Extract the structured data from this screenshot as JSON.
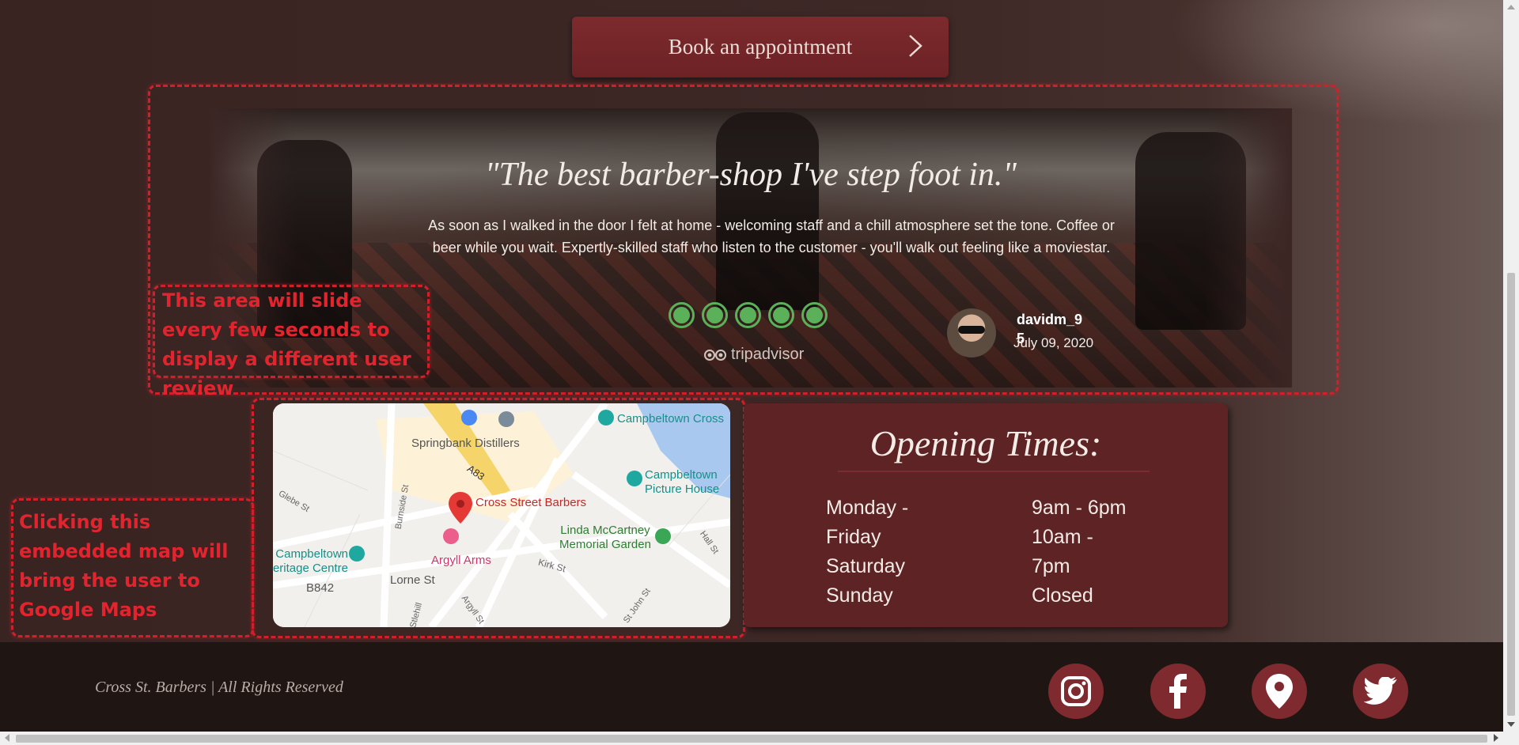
{
  "book_button": {
    "label": "Book an appointment"
  },
  "review": {
    "quote": "\"The best barber-shop I've step foot in.\"",
    "body": "As soon as I walked in the door I felt at home - welcoming staff and a chill atmosphere set the tone. Coffee or beer while you wait. Expertly-skilled staff who listen to the customer - you'll walk out feeling like a moviestar.",
    "rating": 5,
    "rating_max": 5,
    "source": "tripadvisor",
    "username": "davidm_95",
    "date": "July 09, 2020"
  },
  "annotations": {
    "slider_note": "This area will slide every few seconds to display a different user review",
    "map_note": "Clicking this embedded map will bring the user to Google Maps"
  },
  "map": {
    "labels": {
      "distillers": "Springbank Distillers",
      "road_a83": "A83",
      "barbers": "Cross Street Barbers",
      "cross": "Campbeltown Cross",
      "picture_house": "Campbeltown Picture House",
      "memorial": "Linda McCartney Memorial Garden",
      "heritage": "Campbeltown Heritage Centre",
      "argyll": "Argyll Arms",
      "b842": "B842",
      "lorne": "Lorne St",
      "kirk": "Kirk St",
      "glebe": "Glebe St",
      "burnside": "Burnside St",
      "hall": "Hall St",
      "john": "St John St",
      "argyll_st": "Argyll St",
      "hill": "Stlehill"
    }
  },
  "opening_times": {
    "title": "Opening Times:",
    "days": [
      "Monday -",
      "Friday",
      "Saturday",
      "Sunday"
    ],
    "hours": [
      "9am - 6pm",
      "10am -",
      "7pm",
      "Closed"
    ]
  },
  "footer": {
    "copyright": "Cross St. Barbers | All Rights Reserved",
    "social": [
      "instagram-icon",
      "facebook-icon",
      "location-icon",
      "twitter-icon"
    ]
  },
  "colors": {
    "accent": "#7e2a2e",
    "background": "#3b2624",
    "rating_green": "#5bb15a",
    "annotation_red": "#e3242f"
  }
}
